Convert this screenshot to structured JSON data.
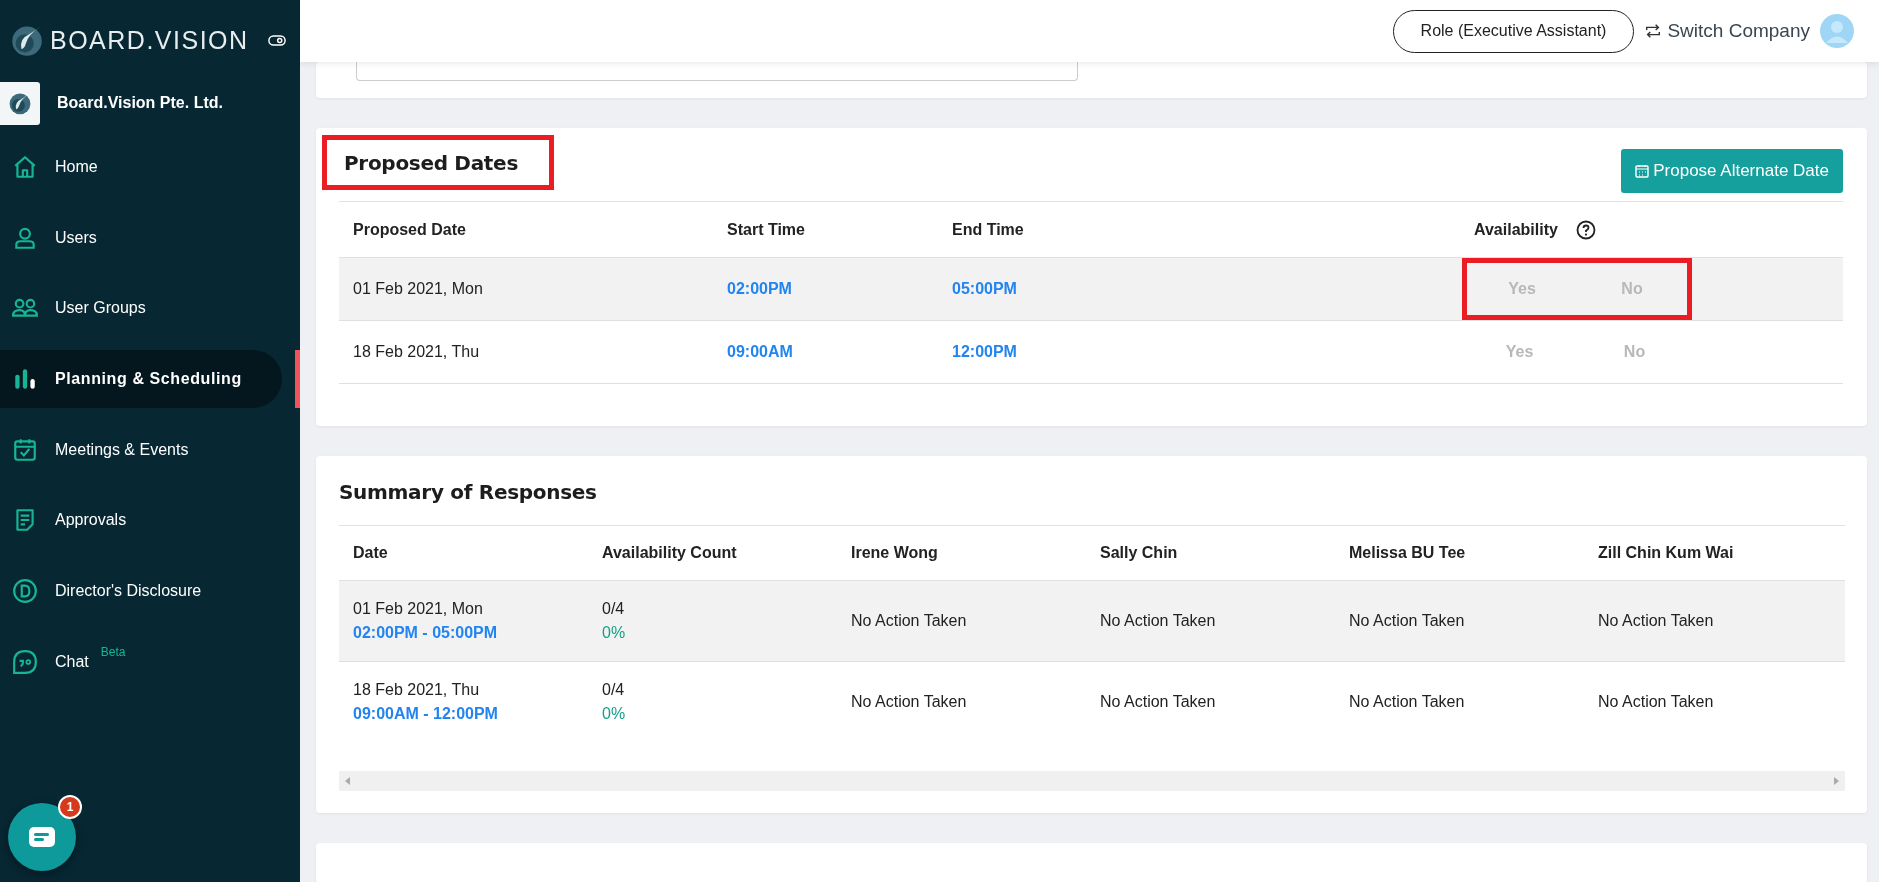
{
  "sidebar": {
    "brand": "BOARD.VISION",
    "company": "Board.Vision Pte. Ltd.",
    "items": [
      {
        "label": "Home",
        "selected": false
      },
      {
        "label": "Users",
        "selected": false
      },
      {
        "label": "User Groups",
        "selected": false
      },
      {
        "label": "Planning & Scheduling",
        "selected": true
      },
      {
        "label": "Meetings & Events",
        "selected": false
      },
      {
        "label": "Approvals",
        "selected": false
      },
      {
        "label": "Director's Disclosure",
        "selected": false
      },
      {
        "label": "Chat",
        "badge": "Beta",
        "selected": false
      }
    ]
  },
  "chat_button": {
    "badge": "1"
  },
  "header": {
    "role_button": "Role (Executive Assistant)",
    "switch_company": "Switch Company"
  },
  "proposed_dates": {
    "title": "Proposed Dates",
    "title_highlighted": true,
    "button": "Propose Alternate Date",
    "columns": [
      "Proposed Date",
      "Start Time",
      "End Time",
      "Availability"
    ],
    "rows": [
      {
        "date": "01 Feb 2021, Mon",
        "start": "02:00PM",
        "end": "05:00PM",
        "availability_highlighted": true,
        "options": [
          {
            "label": "Yes",
            "selected": false
          },
          {
            "label": "No",
            "selected": false
          }
        ]
      },
      {
        "date": "18 Feb 2021, Thu",
        "start": "09:00AM",
        "end": "12:00PM",
        "availability_highlighted": false,
        "options": [
          {
            "label": "Yes",
            "selected": false
          },
          {
            "label": "No",
            "selected": false
          }
        ]
      }
    ]
  },
  "summary": {
    "title": "Summary of Responses",
    "columns": [
      "Date",
      "Availability Count",
      "Irene Wong",
      "Sally Chin",
      "Melissa BU Tee",
      "Zill Chin Kum Wai"
    ],
    "rows": [
      {
        "date": "01 Feb 2021, Mon",
        "time": "02:00PM - 05:00PM",
        "count": "0/4",
        "percent": "0%",
        "responses": [
          "No Action Taken",
          "No Action Taken",
          "No Action Taken",
          "No Action Taken"
        ]
      },
      {
        "date": "18 Feb 2021, Thu",
        "time": "09:00AM - 12:00PM",
        "count": "0/4",
        "percent": "0%",
        "responses": [
          "No Action Taken",
          "No Action Taken",
          "No Action Taken",
          "No Action Taken"
        ]
      }
    ]
  }
}
